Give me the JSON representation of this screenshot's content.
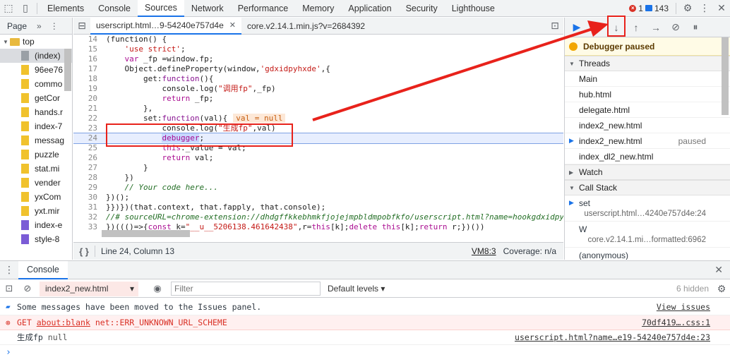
{
  "toolbar": {
    "tabs": [
      "Elements",
      "Console",
      "Sources",
      "Network",
      "Performance",
      "Memory",
      "Application",
      "Security",
      "Lighthouse"
    ],
    "active_tab": "Sources",
    "error_count": "1",
    "message_count": "143"
  },
  "navigator": {
    "tab_label": "Page",
    "top_label": "top",
    "items": [
      {
        "label": "(index)",
        "kind": "file-g",
        "selected": true
      },
      {
        "label": "96ee76",
        "kind": "file-y"
      },
      {
        "label": "commo",
        "kind": "file-y"
      },
      {
        "label": "getCor",
        "kind": "file-y"
      },
      {
        "label": "hands.r",
        "kind": "file-y"
      },
      {
        "label": "index-7",
        "kind": "file-y"
      },
      {
        "label": "messag",
        "kind": "file-y"
      },
      {
        "label": "puzzle",
        "kind": "file-y"
      },
      {
        "label": "stat.mi",
        "kind": "file-y"
      },
      {
        "label": "vender",
        "kind": "file-y"
      },
      {
        "label": "yxCom",
        "kind": "file-y"
      },
      {
        "label": "yxt.mir",
        "kind": "file-y"
      },
      {
        "label": "index-e",
        "kind": "file-p"
      },
      {
        "label": "style-8",
        "kind": "file-p"
      }
    ]
  },
  "editor": {
    "tabs": [
      {
        "label": "userscript.html…9-54240e757d4e",
        "active": true
      },
      {
        "label": "core.v2.14.1.min.js?v=2684392",
        "active": false
      }
    ],
    "line_numbers": [
      "14",
      "15",
      "16",
      "17",
      "18",
      "19",
      "20",
      "21",
      "22",
      "23",
      "24",
      "25",
      "26",
      "27",
      "28",
      "29",
      "30",
      "31",
      "32",
      "33"
    ],
    "lines": {
      "l14": "(function() {",
      "l15_kw": "'use strict'",
      "l16_kw": "var",
      "l16_rest": " _fp =window.fp;",
      "l17_a": "Object.defineProperty(window,",
      "l17_str": "'gdxidpyhxde'",
      "l17_b": ",{",
      "l18_a": "get:",
      "l18_fn": "function",
      "l18_b": "(){",
      "l19_a": "console.log(",
      "l19_str": "\"调用fp\"",
      "l19_b": ",_fp)",
      "l20_kw": "return",
      "l20_rest": " _fp;",
      "l21": "},",
      "l22_a": "set:",
      "l22_fn": "function",
      "l22_b": "(val){",
      "l22_inline": "val = null",
      "l23_a": "console.log(",
      "l23_str": "\"生成fp\"",
      "l23_b": ",val)",
      "l24_kw": "debugger",
      "l24_rest": ";",
      "l25_kw": "this",
      "l25_rest": "._value = val;",
      "l26_kw": "return",
      "l26_rest": " val;",
      "l27": "}",
      "l28": "})",
      "l29": "// Your code here...",
      "l30": "})();",
      "l31": "}})})(that.context, that.fapply, that.console);",
      "l32": "//# sourceURL=chrome-extension://dhdgffkkebhmkfjojejmpbldmpobfkfo/userscript.html?name=hookgdxidpyhxde",
      "l33_a": "})((()=>{",
      "l33_kw": "const",
      "l33_b": " k=",
      "l33_str": "\"__u__5206138.461642438\"",
      "l33_c": ",r=",
      "l33_kw2": "this",
      "l33_d": "[k];",
      "l33_kw3": "delete",
      "l33_e": " ",
      "l33_kw4": "this",
      "l33_f": "[k];",
      "l33_kw5": "return",
      "l33_g": " r;})())"
    },
    "status": {
      "position": "Line 24, Column 13",
      "vm": "VM8:3",
      "coverage": "Coverage: n/a"
    }
  },
  "debugger": {
    "paused_label": "Debugger paused",
    "threads_label": "Threads",
    "threads": [
      {
        "name": "Main",
        "status": ""
      },
      {
        "name": "hub.html",
        "status": ""
      },
      {
        "name": "delegate.html",
        "status": ""
      },
      {
        "name": "index2_new.html",
        "status": ""
      },
      {
        "name": "index2_new.html",
        "status": "paused",
        "current": true
      },
      {
        "name": "index_dl2_new.html",
        "status": ""
      }
    ],
    "watch_label": "Watch",
    "callstack_label": "Call Stack",
    "frames": [
      {
        "name": "set",
        "loc": "userscript.html…4240e757d4e:24",
        "current": true
      },
      {
        "name": "W",
        "loc": "core.v2.14.1.mi…formatted:6962"
      },
      {
        "name": "(anonymous)",
        "loc": ""
      }
    ]
  },
  "drawer": {
    "tab_label": "Console",
    "context": "index2_new.html",
    "filter_placeholder": "Filter",
    "levels": "Default levels",
    "hidden": "6 hidden",
    "messages": {
      "info_text": "Some messages have been moved to the Issues panel.",
      "info_link": "View issues",
      "err_get": "GET",
      "err_url": "about:blank",
      "err_text": "net::ERR_UNKNOWN_URL_SCHEME",
      "err_src": "70df419….css:1",
      "log_text": "生成fp",
      "log_val": "null",
      "log_src": "userscript.html?name…e19-54240e757d4e:23"
    }
  },
  "annotation": {
    "color": "#e8221b"
  }
}
